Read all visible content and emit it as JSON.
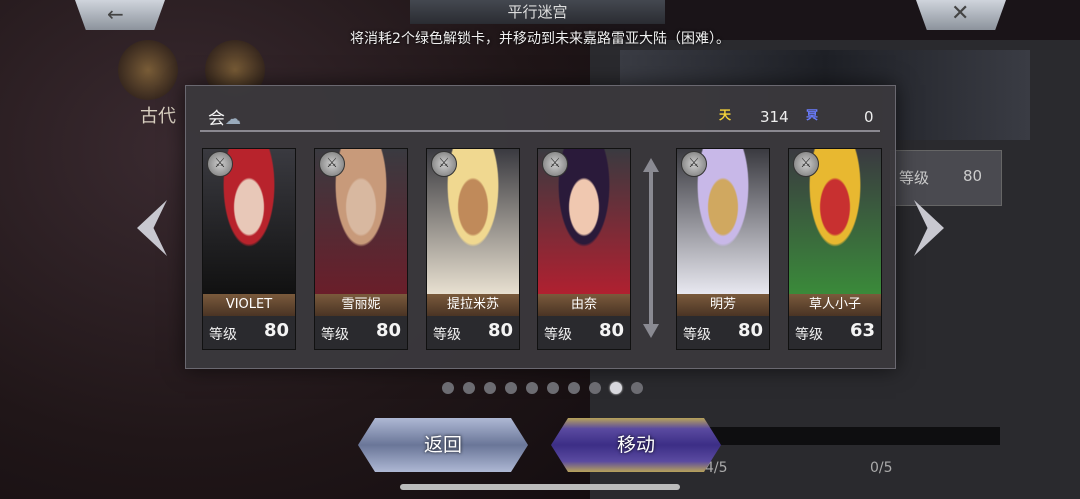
{
  "header": {
    "back_label": "←",
    "close_label": "✕",
    "title": "平行迷宫",
    "instruction": "将消耗2个绿色解锁卡，并移动到未来嘉路雷亚大陆（困难）。"
  },
  "background": {
    "era_label": "古代",
    "level_label": "等级",
    "level_value": "80",
    "counter_left": "4/5",
    "counter_right": "0/5"
  },
  "modal": {
    "title": "会",
    "title_icon": "cloud-rain-icon",
    "currency": [
      {
        "icon": "heaven-icon",
        "symbol": "天",
        "value": "314",
        "color": "#f5d33a"
      },
      {
        "icon": "hell-icon",
        "symbol": "冥",
        "value": "0",
        "color": "#6a7cff"
      }
    ],
    "cards": [
      {
        "name": "VIOLET",
        "level_label": "等级",
        "level": "80",
        "element": "sword-icon",
        "colors": [
          "#b8232c",
          "#111111",
          "#e8c8b8"
        ]
      },
      {
        "name": "雪丽妮",
        "level_label": "等级",
        "level": "80",
        "element": "fist-icon",
        "colors": [
          "#c89a7a",
          "#6a1e2a",
          "#d8b8a0"
        ]
      },
      {
        "name": "提拉米苏",
        "level_label": "等级",
        "level": "80",
        "element": "spear-icon",
        "colors": [
          "#f0d890",
          "#e8e0d0",
          "#c08a5a"
        ]
      },
      {
        "name": "由奈",
        "level_label": "等级",
        "level": "80",
        "element": "magic-icon",
        "colors": [
          "#2a1a3a",
          "#b02030",
          "#f0c8b0"
        ]
      },
      {
        "name": "明芳",
        "level_label": "等级",
        "level": "80",
        "element": "fist-icon",
        "colors": [
          "#c8b8e8",
          "#e8e8f0",
          "#d0a860"
        ]
      },
      {
        "name": "草人小子",
        "level_label": "等级",
        "level": "63",
        "element": "fist-icon",
        "colors": [
          "#e8b830",
          "#3a8a3a",
          "#c83030"
        ]
      }
    ]
  },
  "pager": {
    "count": 10,
    "active_index": 8
  },
  "buttons": {
    "back_label": "返回",
    "move_label": "移动"
  }
}
